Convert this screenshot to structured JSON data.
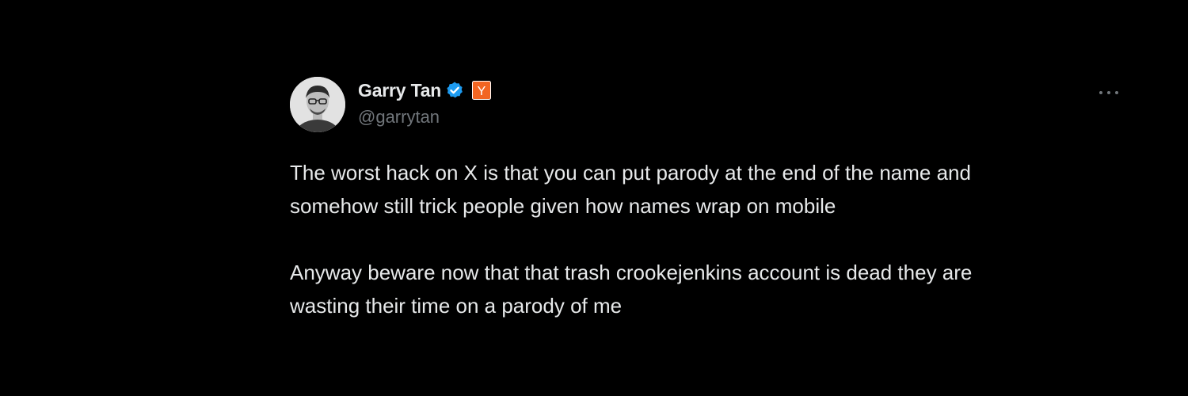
{
  "tweet": {
    "author": {
      "display_name": "Garry Tan",
      "handle": "@garrytan",
      "verified_icon": "verified-badge-icon",
      "verified_color": "#1d9bf0",
      "affiliate_badge": "Y",
      "affiliate_color": "#f26522"
    },
    "body": {
      "paragraph_1_line_1": "The worst hack on X is that you can put parody at the end of the name and",
      "paragraph_1_line_2": "somehow still trick people given how names wrap on mobile",
      "paragraph_2_line_1": "Anyway beware now that that trash crookejenkins account is dead they are",
      "paragraph_2_line_2": "wasting their time on a parody of me"
    },
    "more_icon": "more-horizontal-icon"
  }
}
